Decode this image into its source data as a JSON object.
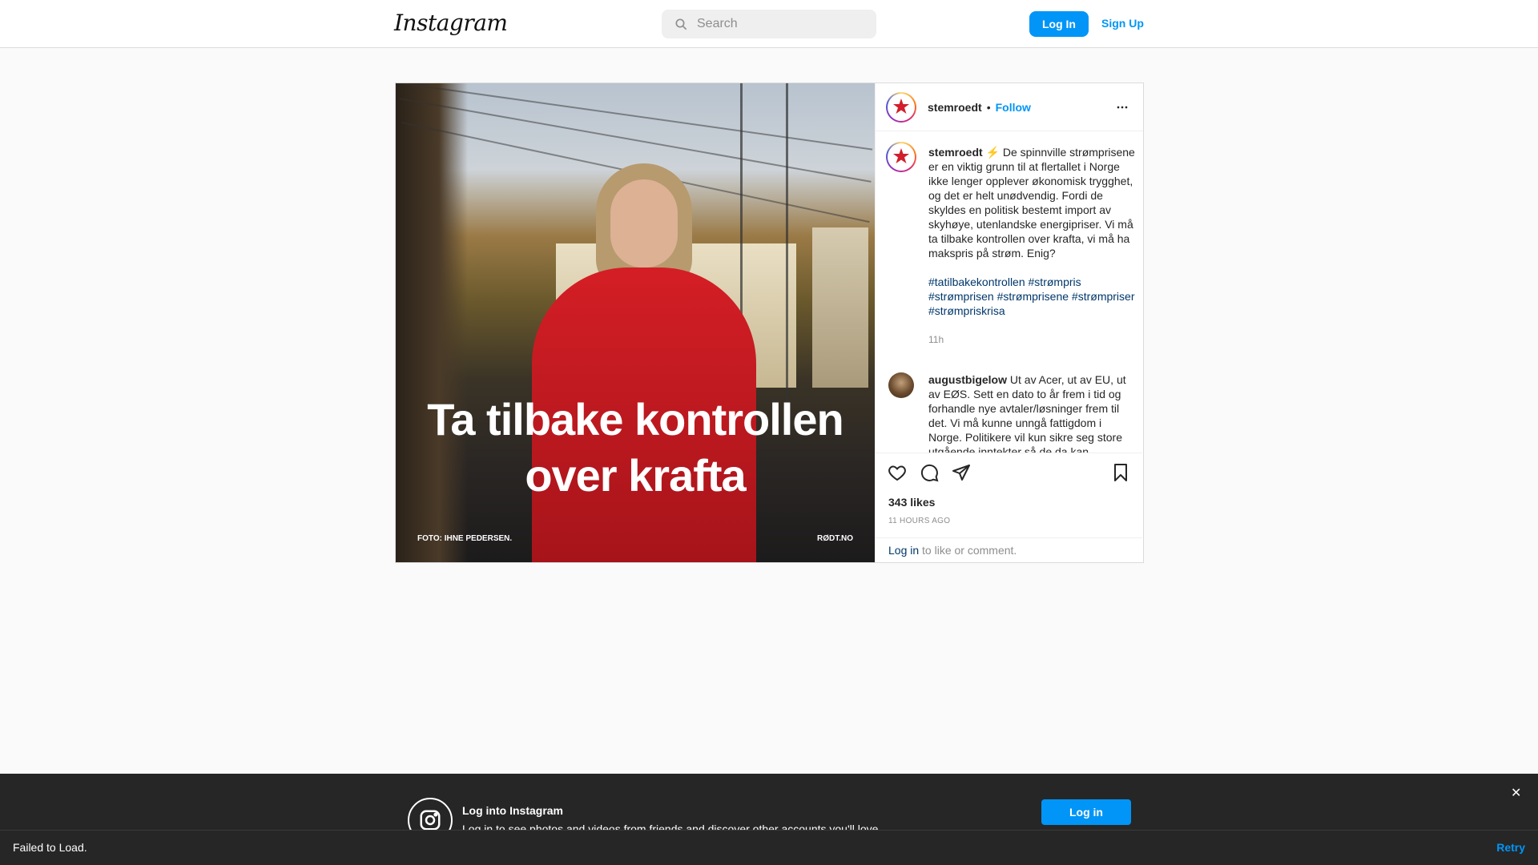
{
  "nav": {
    "logo": "Instagram",
    "search_placeholder": "Search",
    "login_label": "Log In",
    "signup_label": "Sign Up"
  },
  "post": {
    "image_title_line1": "Ta tilbake kontrollen",
    "image_title_line2": "over krafta",
    "image_credit": "FOTO: IHNE PEDERSEN.",
    "image_site": "RØDT.NO",
    "author": "stemroedt",
    "dot": "•",
    "follow_label": "Follow",
    "caption": "⚡ De spinnville strømprisene er en viktig grunn til at flertallet i Norge ikke lenger opplever økonomisk trygghet, og det er helt unødvendig. Fordi de skyldes en politisk bestemt import av skyhøye, utenlandske energipriser. Vi må ta tilbake kontrollen over krafta, vi må ha makspris på strøm. Enig?",
    "hashtags": "#tatilbakekontrollen #strømpris #strømprisen #strømprisene #strømpriser #strømpriskrisa",
    "caption_time": "11h",
    "comment_author": "augustbigelow",
    "comment_text": "Ut av Acer, ut av EU, ut av EØS. Sett en dato to år frem i tid og forhandle nye avtaler/løsninger frem til det. Vi må kunne unngå fattigdom i Norge. Politikere vil kun sikre seg store utgående inntekter så de da kan ...",
    "likes": "343 likes",
    "time_ago": "11 HOURS AGO",
    "login_link": "Log in",
    "login_suffix": " to like or comment."
  },
  "banner": {
    "title": "Log into Instagram",
    "subtitle": "Log in to see photos and videos from friends and discover other accounts you'll love.",
    "login_label": "Log in",
    "close_label": "✕"
  },
  "toast": {
    "message": "Failed to Load.",
    "retry_label": "Retry"
  },
  "colors": {
    "accent": "#0095f6",
    "hashtag": "#00376b"
  }
}
